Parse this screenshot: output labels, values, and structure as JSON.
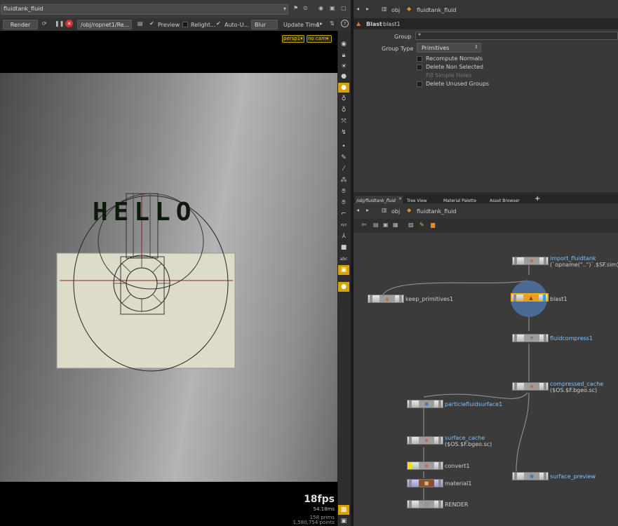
{
  "viewport": {
    "title_field": "fluidtank_fluid",
    "render_button": "Render",
    "render_path": "/obj/ropnet1/Re...",
    "preview_label": "Preview",
    "relight_label": "Relight...",
    "auto_update_label": "Auto-U...",
    "blur_select": "Blur",
    "update_time_label": "Update Time",
    "update_time_value": "1",
    "camera_persp": "persp1▾",
    "camera_nocam": "no cam▾",
    "scene_text": "HELLO",
    "fps": "18fps",
    "frame_time": "54.18ms",
    "prims": "158  prims",
    "points": "1,580,754 points"
  },
  "parameter_pane": {
    "path_obj": "obj",
    "path_node": "fluidtank_fluid",
    "node_type": "Blast",
    "node_name": "blast1",
    "group_label": "Group",
    "group_value": "*",
    "group_type_label": "Group Type",
    "group_type_value": "Primitives",
    "checkboxes": [
      {
        "label": "Recompute Normals",
        "enabled": true
      },
      {
        "label": "Delete Non Selected",
        "enabled": true
      },
      {
        "label": "Fill Simple Holes",
        "enabled": false
      },
      {
        "label": "Delete Unused Groups",
        "enabled": true
      }
    ]
  },
  "network_pane": {
    "tabs": [
      "/obj/fluidtank_fluid",
      "Tree View",
      "Material Palette",
      "Asset Browser"
    ],
    "add_tab": "+",
    "path_obj": "obj",
    "path_node": "fluidtank_fluid",
    "nodes": {
      "import_fluidtank": {
        "name": "import_fluidtank",
        "sub": "(`opname(\"..\")`.$SF.sim)"
      },
      "keep_primitives1": {
        "name": "keep_primitives1"
      },
      "blast1": {
        "name": "blast1"
      },
      "fluidcompress1": {
        "name": "fluidcompress1"
      },
      "compressed_cache": {
        "name": "compressed_cache",
        "sub": "($OS.$F.bgeo.sc)"
      },
      "particlefluidsurface1": {
        "name": "particlefluidsurface1"
      },
      "surface_cache": {
        "name": "surface_cache",
        "sub": "($OS.$F.bgeo.sc)"
      },
      "convert1": {
        "name": "convert1"
      },
      "material1": {
        "name": "material1"
      },
      "render": {
        "name": "RENDER"
      },
      "surface_preview": {
        "name": "surface_preview"
      }
    }
  },
  "toolbar_side": {
    "abc_label": "abc",
    "xyz_label": "xyz"
  },
  "colors": {
    "viewport_bg": "#000000",
    "selected_node": "#f0b400",
    "link_blue": "#7fc4ff"
  }
}
